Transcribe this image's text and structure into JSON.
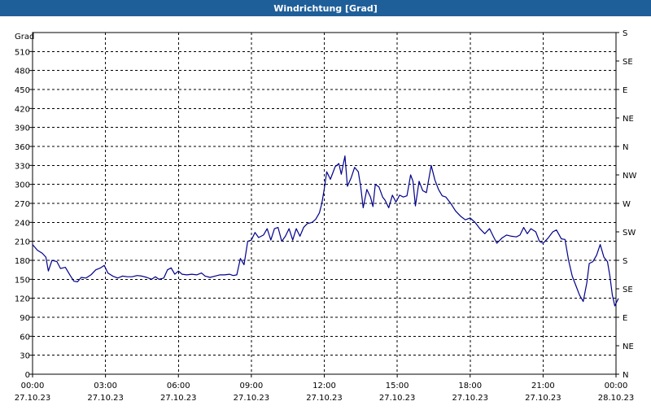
{
  "window": {
    "title": "Windrichtung [Grad]"
  },
  "chart_data": {
    "type": "line",
    "title": "Windrichtung [Grad]",
    "ylabel": "Grad",
    "ylim": [
      0,
      540
    ],
    "xlim_hours": [
      0,
      24
    ],
    "y_ticks": [
      0,
      30,
      60,
      90,
      120,
      150,
      180,
      210,
      240,
      270,
      300,
      330,
      360,
      390,
      420,
      450,
      480,
      510
    ],
    "x_ticks": [
      {
        "hour": 0,
        "time": "00:00",
        "date": "27.10.23"
      },
      {
        "hour": 3,
        "time": "03:00",
        "date": "27.10.23"
      },
      {
        "hour": 6,
        "time": "06:00",
        "date": "27.10.23"
      },
      {
        "hour": 9,
        "time": "09:00",
        "date": "27.10.23"
      },
      {
        "hour": 12,
        "time": "12:00",
        "date": "27.10.23"
      },
      {
        "hour": 15,
        "time": "15:00",
        "date": "27.10.23"
      },
      {
        "hour": 18,
        "time": "18:00",
        "date": "27.10.23"
      },
      {
        "hour": 21,
        "time": "21:00",
        "date": "27.10.23"
      },
      {
        "hour": 24,
        "time": "00:00",
        "date": "28.10.23"
      }
    ],
    "right_axis": [
      {
        "value": 0,
        "label": "N"
      },
      {
        "value": 45,
        "label": "NE"
      },
      {
        "value": 90,
        "label": "E"
      },
      {
        "value": 135,
        "label": "SE"
      },
      {
        "value": 180,
        "label": "S"
      },
      {
        "value": 225,
        "label": "SW"
      },
      {
        "value": 270,
        "label": "W"
      },
      {
        "value": 315,
        "label": "NW"
      },
      {
        "value": 360,
        "label": "N"
      },
      {
        "value": 405,
        "label": "NE"
      },
      {
        "value": 450,
        "label": "E"
      },
      {
        "value": 495,
        "label": "SE"
      },
      {
        "value": 540,
        "label": "S"
      }
    ],
    "grid": true,
    "series": [
      {
        "color": "#00008b",
        "points": [
          [
            0.0,
            205
          ],
          [
            0.2,
            196
          ],
          [
            0.4,
            191
          ],
          [
            0.55,
            185
          ],
          [
            0.65,
            163
          ],
          [
            0.8,
            180
          ],
          [
            1.0,
            178
          ],
          [
            1.15,
            167
          ],
          [
            1.35,
            169
          ],
          [
            1.55,
            156
          ],
          [
            1.7,
            147
          ],
          [
            1.85,
            146
          ],
          [
            2.0,
            153
          ],
          [
            2.2,
            152
          ],
          [
            2.4,
            157
          ],
          [
            2.6,
            165
          ],
          [
            2.8,
            168
          ],
          [
            2.95,
            172
          ],
          [
            3.1,
            160
          ],
          [
            3.3,
            155
          ],
          [
            3.5,
            152
          ],
          [
            3.7,
            155
          ],
          [
            3.9,
            154
          ],
          [
            4.1,
            154
          ],
          [
            4.3,
            156
          ],
          [
            4.5,
            155
          ],
          [
            4.7,
            153
          ],
          [
            4.9,
            150
          ],
          [
            5.05,
            154
          ],
          [
            5.2,
            150
          ],
          [
            5.4,
            152
          ],
          [
            5.55,
            165
          ],
          [
            5.7,
            168
          ],
          [
            5.85,
            158
          ],
          [
            6.0,
            163
          ],
          [
            6.15,
            158
          ],
          [
            6.35,
            157
          ],
          [
            6.55,
            158
          ],
          [
            6.75,
            157
          ],
          [
            6.95,
            160
          ],
          [
            7.1,
            155
          ],
          [
            7.3,
            153
          ],
          [
            7.5,
            155
          ],
          [
            7.7,
            157
          ],
          [
            7.9,
            157
          ],
          [
            8.1,
            158
          ],
          [
            8.25,
            156
          ],
          [
            8.4,
            157
          ],
          [
            8.55,
            183
          ],
          [
            8.7,
            173
          ],
          [
            8.85,
            210
          ],
          [
            9.0,
            212
          ],
          [
            9.15,
            224
          ],
          [
            9.3,
            216
          ],
          [
            9.5,
            220
          ],
          [
            9.65,
            230
          ],
          [
            9.8,
            212
          ],
          [
            9.95,
            230
          ],
          [
            10.1,
            232
          ],
          [
            10.25,
            210
          ],
          [
            10.4,
            218
          ],
          [
            10.55,
            230
          ],
          [
            10.7,
            212
          ],
          [
            10.85,
            230
          ],
          [
            11.0,
            218
          ],
          [
            11.15,
            232
          ],
          [
            11.3,
            238
          ],
          [
            11.5,
            240
          ],
          [
            11.65,
            245
          ],
          [
            11.8,
            255
          ],
          [
            11.9,
            270
          ],
          [
            12.0,
            293
          ],
          [
            12.1,
            320
          ],
          [
            12.25,
            308
          ],
          [
            12.45,
            328
          ],
          [
            12.6,
            333
          ],
          [
            12.7,
            316
          ],
          [
            12.85,
            345
          ],
          [
            12.95,
            297
          ],
          [
            13.1,
            310
          ],
          [
            13.25,
            327
          ],
          [
            13.4,
            320
          ],
          [
            13.5,
            296
          ],
          [
            13.6,
            263
          ],
          [
            13.75,
            292
          ],
          [
            13.9,
            280
          ],
          [
            14.0,
            265
          ],
          [
            14.1,
            300
          ],
          [
            14.25,
            296
          ],
          [
            14.4,
            280
          ],
          [
            14.5,
            275
          ],
          [
            14.65,
            263
          ],
          [
            14.8,
            283
          ],
          [
            14.95,
            272
          ],
          [
            15.1,
            283
          ],
          [
            15.25,
            280
          ],
          [
            15.4,
            282
          ],
          [
            15.55,
            315
          ],
          [
            15.65,
            305
          ],
          [
            15.75,
            266
          ],
          [
            15.9,
            305
          ],
          [
            16.05,
            290
          ],
          [
            16.2,
            287
          ],
          [
            16.4,
            330
          ],
          [
            16.55,
            307
          ],
          [
            16.7,
            292
          ],
          [
            16.85,
            282
          ],
          [
            17.0,
            280
          ],
          [
            17.2,
            270
          ],
          [
            17.4,
            258
          ],
          [
            17.6,
            250
          ],
          [
            17.8,
            244
          ],
          [
            18.0,
            247
          ],
          [
            18.2,
            240
          ],
          [
            18.4,
            230
          ],
          [
            18.6,
            222
          ],
          [
            18.8,
            230
          ],
          [
            18.95,
            218
          ],
          [
            19.1,
            207
          ],
          [
            19.3,
            215
          ],
          [
            19.5,
            220
          ],
          [
            19.7,
            218
          ],
          [
            19.9,
            217
          ],
          [
            20.05,
            220
          ],
          [
            20.2,
            232
          ],
          [
            20.35,
            222
          ],
          [
            20.5,
            230
          ],
          [
            20.7,
            225
          ],
          [
            20.85,
            210
          ],
          [
            21.0,
            207
          ],
          [
            21.2,
            215
          ],
          [
            21.4,
            225
          ],
          [
            21.55,
            228
          ],
          [
            21.75,
            214
          ],
          [
            21.9,
            213
          ],
          [
            22.05,
            180
          ],
          [
            22.2,
            155
          ],
          [
            22.35,
            140
          ],
          [
            22.5,
            125
          ],
          [
            22.65,
            115
          ],
          [
            22.8,
            145
          ],
          [
            22.9,
            175
          ],
          [
            23.05,
            178
          ],
          [
            23.2,
            188
          ],
          [
            23.35,
            205
          ],
          [
            23.5,
            185
          ],
          [
            23.65,
            178
          ],
          [
            23.75,
            155
          ],
          [
            23.85,
            125
          ],
          [
            23.95,
            108
          ],
          [
            24.1,
            120
          ]
        ]
      }
    ]
  }
}
